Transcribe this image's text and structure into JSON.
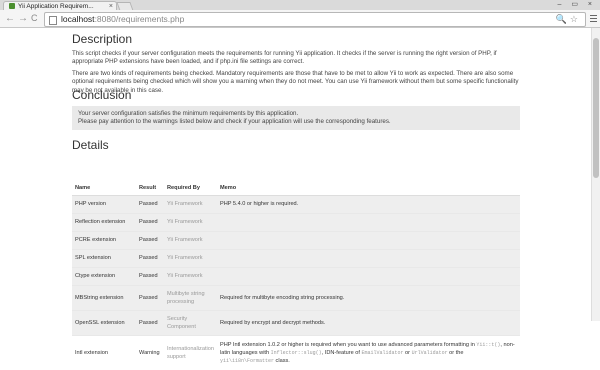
{
  "browser": {
    "tab_title": "Yii Application Requirem...",
    "tab_close": "×",
    "window_controls": "– ▭ ×",
    "back": "←",
    "forward": "→",
    "reload": "C",
    "url_host": "localhost",
    "url_rest": ":8080/requirements.php",
    "omni_icons": "🔍☆"
  },
  "description": {
    "heading": "Description",
    "p1": "This script checks if your server configuration meets the requirements for running Yii application. It checks if the server is running the right version of PHP, if appropriate PHP extensions have been loaded, and if php.ini file settings are correct.",
    "p2": "There are two kinds of requirements being checked. Mandatory requirements are those that have to be met to allow Yii to work as expected. There are also some optional requirements being checked which will show you a warning when they do not meet. You can use Yii framework without them but some specific functionality may be not available in this case."
  },
  "conclusion": {
    "heading": "Conclusion",
    "line1": "Your server configuration satisfies the minimum requirements by this application.",
    "line2": "Please pay attention to the warnings listed below and check if your application will use the corresponding features."
  },
  "details": {
    "heading": "Details",
    "columns": [
      "Name",
      "Result",
      "Required By",
      "Memo"
    ],
    "rows": [
      {
        "name": "PHP version",
        "result": "Passed",
        "required_by": "Yii Framework",
        "memo": "PHP 5.4.0 or higher is required."
      },
      {
        "name": "Reflection extension",
        "result": "Passed",
        "required_by": "Yii Framework",
        "memo": ""
      },
      {
        "name": "PCRE extension",
        "result": "Passed",
        "required_by": "Yii Framework",
        "memo": ""
      },
      {
        "name": "SPL extension",
        "result": "Passed",
        "required_by": "Yii Framework",
        "memo": ""
      },
      {
        "name": "Ctype extension",
        "result": "Passed",
        "required_by": "Yii Framework",
        "memo": ""
      },
      {
        "name": "MBString extension",
        "result": "Passed",
        "required_by": "Multibyte string processing",
        "memo": "Required for multibyte encoding string processing."
      },
      {
        "name": "OpenSSL extension",
        "result": "Passed",
        "required_by": "Security Component",
        "memo": "Required by encrypt and decrypt methods."
      },
      {
        "name": "Intl extension",
        "result": "Warning",
        "required_by": "Internationalization support",
        "memo_a": "PHP Intl extension 1.0.2 or higher is required when you want to use advanced parameters formatting in ",
        "memo_code1": "Yii::t()",
        "memo_b": ", non-latin languages with ",
        "memo_code2": "Inflector::slug()",
        "memo_c": ", IDN-feature of ",
        "memo_code3": "EmailValidator",
        "memo_d": " or ",
        "memo_code4": "UrlValidator",
        "memo_e": " or the ",
        "memo_code5": "yii\\i18n\\Formatter",
        "memo_f": " class."
      }
    ]
  }
}
